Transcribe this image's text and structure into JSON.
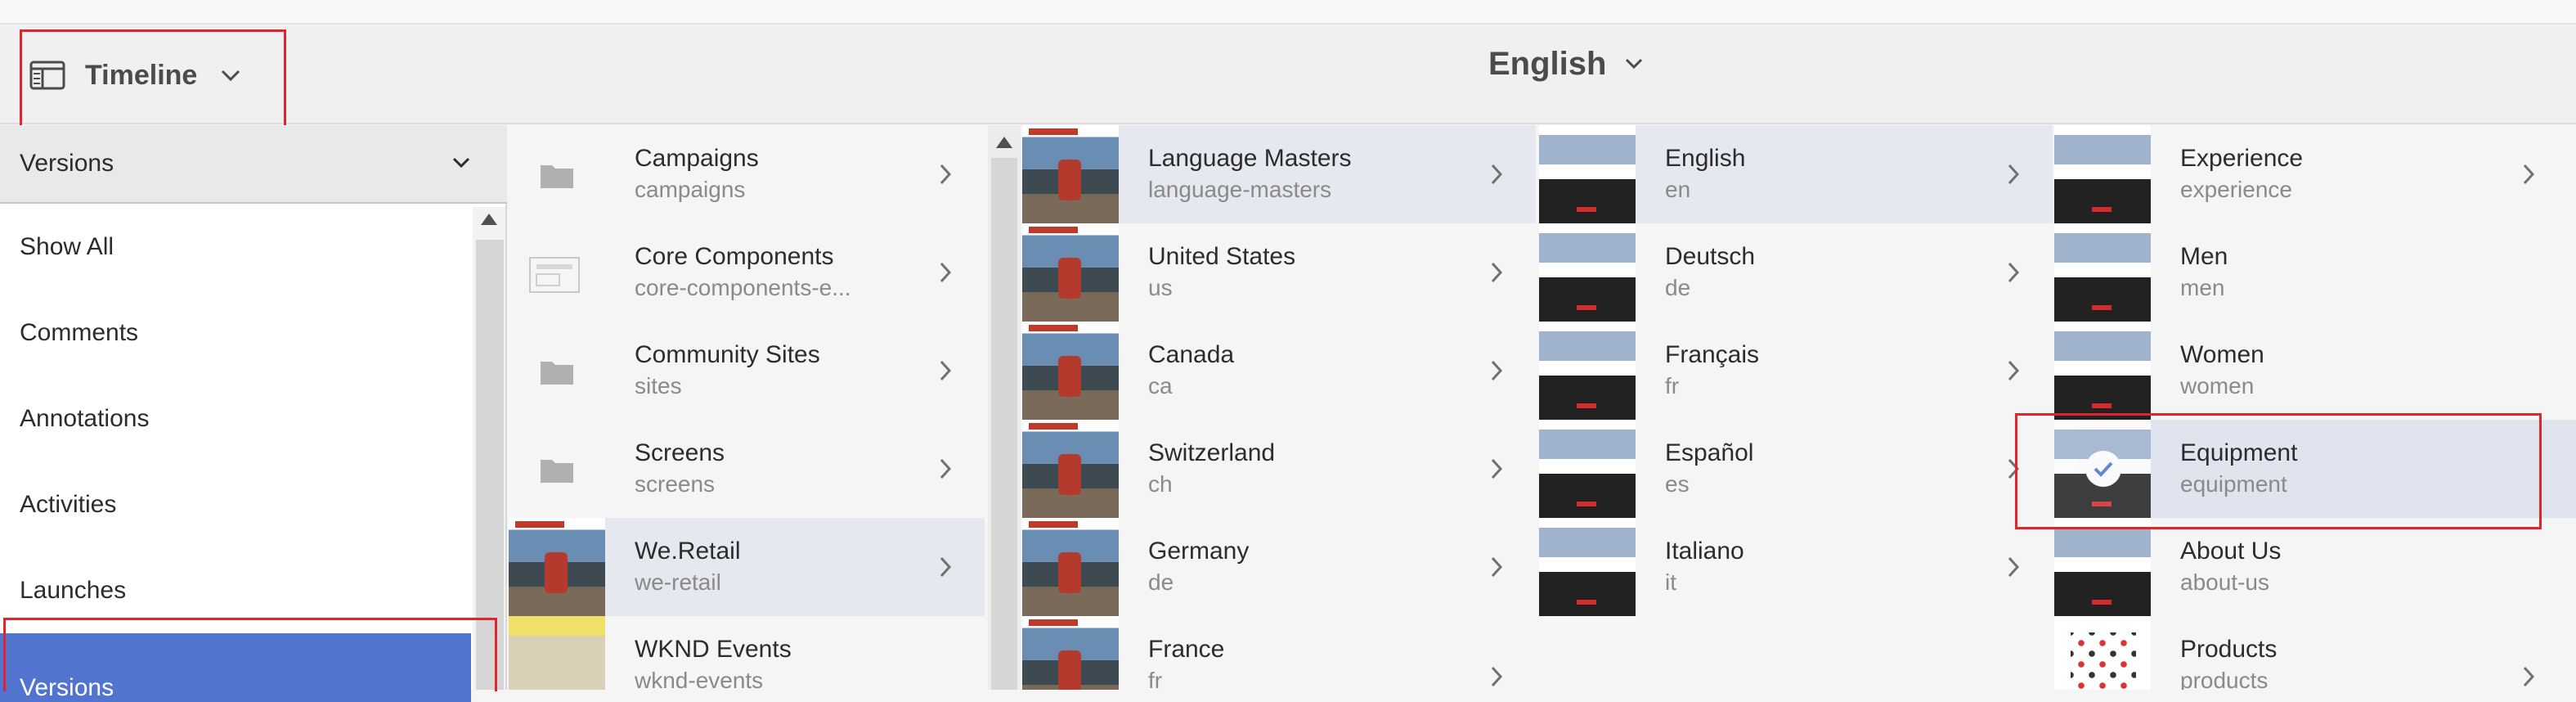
{
  "header": {
    "timeline_label": "Timeline",
    "language_title": "English"
  },
  "rail": {
    "select_label": "Versions",
    "items": [
      {
        "label": "Show All"
      },
      {
        "label": "Comments"
      },
      {
        "label": "Annotations"
      },
      {
        "label": "Activities"
      },
      {
        "label": "Launches"
      },
      {
        "label": "Versions"
      }
    ]
  },
  "columns": {
    "sites": [
      {
        "title": "Campaigns",
        "sub": "campaigns"
      },
      {
        "title": "Core Components",
        "sub": "core-components-e..."
      },
      {
        "title": "Community Sites",
        "sub": "sites"
      },
      {
        "title": "Screens",
        "sub": "screens"
      },
      {
        "title": "We.Retail",
        "sub": "we-retail"
      },
      {
        "title": "WKND Events",
        "sub": "wknd-events"
      }
    ],
    "regions": [
      {
        "title": "Language Masters",
        "sub": "language-masters"
      },
      {
        "title": "United States",
        "sub": "us"
      },
      {
        "title": "Canada",
        "sub": "ca"
      },
      {
        "title": "Switzerland",
        "sub": "ch"
      },
      {
        "title": "Germany",
        "sub": "de"
      },
      {
        "title": "France",
        "sub": "fr"
      }
    ],
    "languages": [
      {
        "title": "English",
        "sub": "en"
      },
      {
        "title": "Deutsch",
        "sub": "de"
      },
      {
        "title": "Français",
        "sub": "fr"
      },
      {
        "title": "Español",
        "sub": "es"
      },
      {
        "title": "Italiano",
        "sub": "it"
      }
    ],
    "pages": [
      {
        "title": "Experience",
        "sub": "experience"
      },
      {
        "title": "Men",
        "sub": "men"
      },
      {
        "title": "Women",
        "sub": "women"
      },
      {
        "title": "Equipment",
        "sub": "equipment"
      },
      {
        "title": "About Us",
        "sub": "about-us"
      },
      {
        "title": "Products",
        "sub": "products"
      }
    ]
  },
  "colors": {
    "selected_rail": "#5175ce",
    "highlight_box": "#e0252d",
    "active_row": "#e5e8ee"
  }
}
